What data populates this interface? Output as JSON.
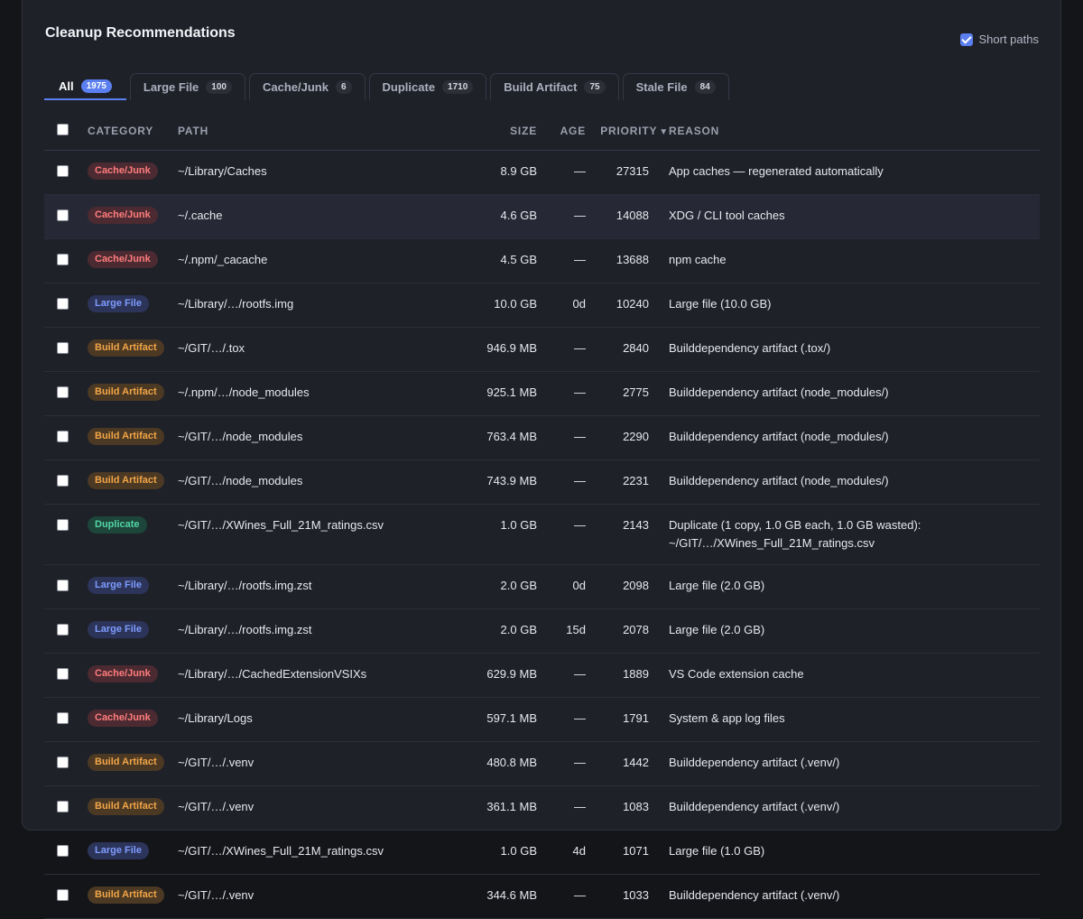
{
  "panel": {
    "title": "Cleanup Recommendations",
    "short_paths_label": "Short paths",
    "short_paths_checked": true
  },
  "tabs": [
    {
      "label": "All",
      "count": "1975",
      "active": true
    },
    {
      "label": "Large File",
      "count": "100"
    },
    {
      "label": "Cache/Junk",
      "count": "6"
    },
    {
      "label": "Duplicate",
      "count": "1710"
    },
    {
      "label": "Build Artifact",
      "count": "75"
    },
    {
      "label": "Stale File",
      "count": "84"
    }
  ],
  "table": {
    "headers": {
      "category": "CATEGORY",
      "path": "PATH",
      "size": "SIZE",
      "age": "AGE",
      "priority": "PRIORITY",
      "reason": "REASON"
    },
    "sort_icon": "sort-down-icon",
    "rows": [
      {
        "category": "Cache/Junk",
        "kind": "cache",
        "path": "~/Library/Caches",
        "size": "8.9 GB",
        "age": "—",
        "priority": "27315",
        "reason": "App caches — regenerated automatically"
      },
      {
        "category": "Cache/Junk",
        "kind": "cache",
        "path": "~/.cache",
        "size": "4.6 GB",
        "age": "—",
        "priority": "14088",
        "reason": "XDG / CLI tool caches",
        "highlight": true
      },
      {
        "category": "Cache/Junk",
        "kind": "cache",
        "path": "~/.npm/_cacache",
        "size": "4.5 GB",
        "age": "—",
        "priority": "13688",
        "reason": "npm cache"
      },
      {
        "category": "Large File",
        "kind": "large",
        "path": "~/Library/…/rootfs.img",
        "size": "10.0 GB",
        "age": "0d",
        "priority": "10240",
        "reason": "Large file (10.0 GB)"
      },
      {
        "category": "Build Artifact",
        "kind": "build",
        "path": "~/GIT/…/.tox",
        "size": "946.9 MB",
        "age": "—",
        "priority": "2840",
        "reason": "Builddependency artifact (.tox/)"
      },
      {
        "category": "Build Artifact",
        "kind": "build",
        "path": "~/.npm/…/node_modules",
        "size": "925.1 MB",
        "age": "—",
        "priority": "2775",
        "reason": "Builddependency artifact (node_modules/)"
      },
      {
        "category": "Build Artifact",
        "kind": "build",
        "path": "~/GIT/…/node_modules",
        "size": "763.4 MB",
        "age": "—",
        "priority": "2290",
        "reason": "Builddependency artifact (node_modules/)"
      },
      {
        "category": "Build Artifact",
        "kind": "build",
        "path": "~/GIT/…/node_modules",
        "size": "743.9 MB",
        "age": "—",
        "priority": "2231",
        "reason": "Builddependency artifact (node_modules/)"
      },
      {
        "category": "Duplicate",
        "kind": "dup",
        "path": "~/GIT/…/XWines_Full_21M_ratings.csv",
        "size": "1.0 GB",
        "age": "—",
        "priority": "2143",
        "reason": "Duplicate (1 copy, 1.0 GB each, 1.0 GB wasted): ~/GIT/…/XWines_Full_21M_ratings.csv"
      },
      {
        "category": "Large File",
        "kind": "large",
        "path": "~/Library/…/rootfs.img.zst",
        "size": "2.0 GB",
        "age": "0d",
        "priority": "2098",
        "reason": "Large file (2.0 GB)"
      },
      {
        "category": "Large File",
        "kind": "large",
        "path": "~/Library/…/rootfs.img.zst",
        "size": "2.0 GB",
        "age": "15d",
        "priority": "2078",
        "reason": "Large file (2.0 GB)"
      },
      {
        "category": "Cache/Junk",
        "kind": "cache",
        "path": "~/Library/…/CachedExtensionVSIXs",
        "size": "629.9 MB",
        "age": "—",
        "priority": "1889",
        "reason": "VS Code extension cache"
      },
      {
        "category": "Cache/Junk",
        "kind": "cache",
        "path": "~/Library/Logs",
        "size": "597.1 MB",
        "age": "—",
        "priority": "1791",
        "reason": "System & app log files"
      },
      {
        "category": "Build Artifact",
        "kind": "build",
        "path": "~/GIT/…/.venv",
        "size": "480.8 MB",
        "age": "—",
        "priority": "1442",
        "reason": "Builddependency artifact (.venv/)"
      },
      {
        "category": "Build Artifact",
        "kind": "build",
        "path": "~/GIT/…/.venv",
        "size": "361.1 MB",
        "age": "—",
        "priority": "1083",
        "reason": "Builddependency artifact (.venv/)"
      },
      {
        "category": "Large File",
        "kind": "large",
        "path": "~/GIT/…/XWines_Full_21M_ratings.csv",
        "size": "1.0 GB",
        "age": "4d",
        "priority": "1071",
        "reason": "Large file (1.0 GB)"
      },
      {
        "category": "Build Artifact",
        "kind": "build",
        "path": "~/GIT/…/.venv",
        "size": "344.6 MB",
        "age": "—",
        "priority": "1033",
        "reason": "Builddependency artifact (.venv/)"
      }
    ]
  }
}
